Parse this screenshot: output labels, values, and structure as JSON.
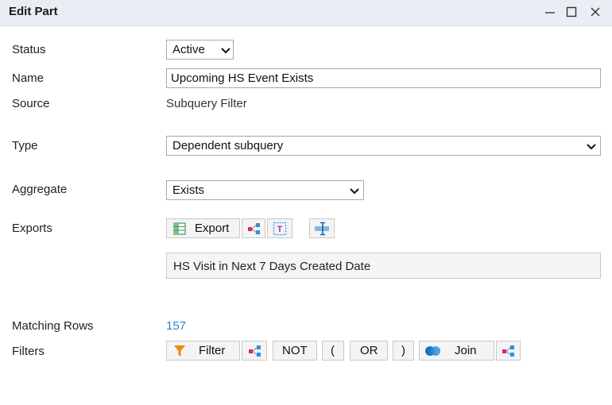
{
  "window": {
    "title": "Edit Part",
    "controls": [
      "minimize-icon",
      "maximize-icon",
      "close-icon"
    ]
  },
  "form": {
    "status": {
      "label": "Status",
      "value": "Active"
    },
    "name": {
      "label": "Name",
      "value": "Upcoming HS Event Exists"
    },
    "source": {
      "label": "Source",
      "value": "Subquery Filter"
    },
    "type": {
      "label": "Type",
      "value": "Dependent subquery"
    },
    "aggregate": {
      "label": "Aggregate",
      "value": "Exists"
    },
    "exports": {
      "label": "Exports",
      "export_label": "Export",
      "selected_export": "HS Visit in Next 7 Days Created Date"
    },
    "matching_rows": {
      "label": "Matching Rows",
      "value": "157"
    },
    "filters": {
      "label": "Filters",
      "filter_label": "Filter",
      "not_label": "NOT",
      "open_paren": "(",
      "or_label": "OR",
      "close_paren": ")",
      "join_label": "Join"
    }
  },
  "colors": {
    "titlebar": "#e9eef5",
    "link": "#2a86d1",
    "icon_magenta": "#e0207a",
    "icon_blue": "#2f8fe0",
    "filter_orange": "#f08a00"
  }
}
